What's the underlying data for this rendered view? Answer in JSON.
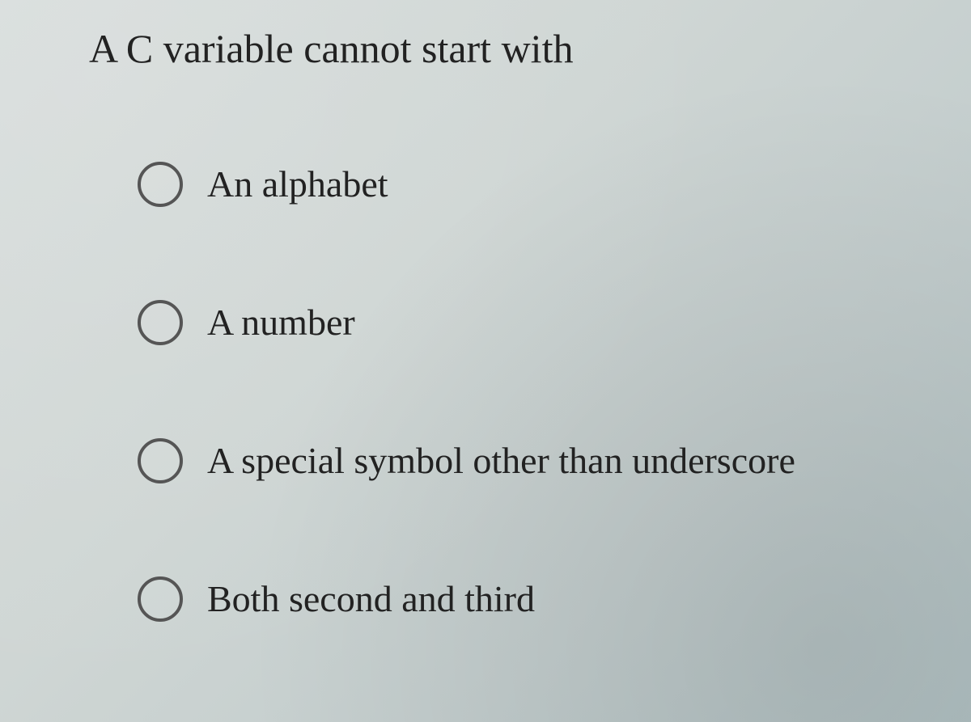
{
  "question": {
    "text": "A C variable cannot start with"
  },
  "options": [
    {
      "label": "An alphabet"
    },
    {
      "label": "A number"
    },
    {
      "label": "A special symbol other than underscore"
    },
    {
      "label": "Both second and third"
    }
  ]
}
